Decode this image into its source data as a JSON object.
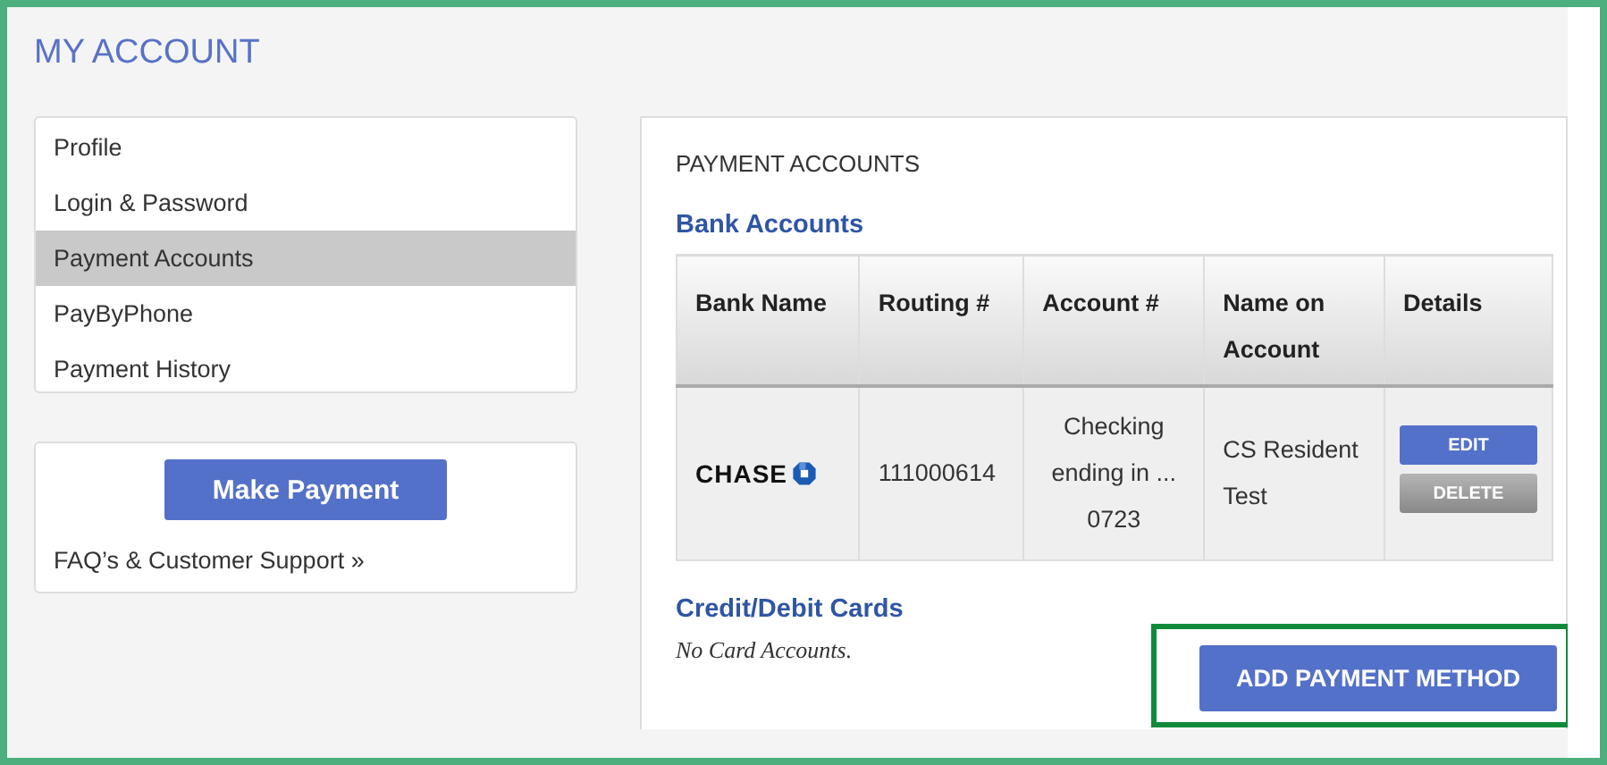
{
  "page": {
    "title": "MY ACCOUNT"
  },
  "sidebar": {
    "items": [
      {
        "label": "Profile",
        "selected": false
      },
      {
        "label": "Login & Password",
        "selected": false
      },
      {
        "label": "Payment Accounts",
        "selected": true
      },
      {
        "label": "PayByPhone",
        "selected": false
      },
      {
        "label": "Payment History",
        "selected": false
      }
    ]
  },
  "support_box": {
    "button": "Make Payment",
    "link": "FAQ’s & Customer Support »"
  },
  "main": {
    "heading": "PAYMENT ACCOUNTS",
    "bank_section": {
      "title": "Bank Accounts",
      "table": {
        "columns": [
          "Bank Name",
          "Routing #",
          "Account #",
          "Name on Account",
          "Details"
        ],
        "rows": [
          {
            "bank": {
              "kind": "logo",
              "text": "CHASE"
            },
            "routing": "111000614",
            "account": "Checking ending in ... 0723",
            "name": "CS Resident Test",
            "actions": [
              {
                "label": "EDIT",
                "kind": "primary"
              },
              {
                "label": "DELETE",
                "kind": "secondary"
              }
            ]
          }
        ]
      }
    },
    "cards_section": {
      "title": "Credit/Debit Cards",
      "empty_text": "No Card Accounts."
    },
    "add_button": {
      "label": "ADD PAYMENT METHOD",
      "highlighted": true
    }
  }
}
